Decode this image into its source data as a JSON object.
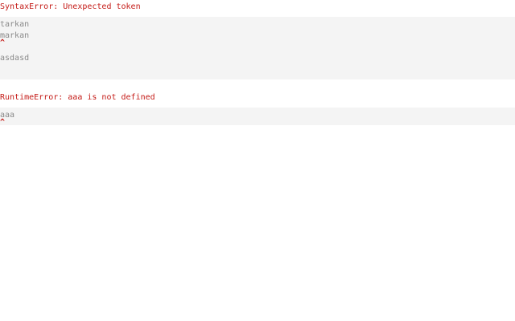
{
  "errors": [
    {
      "title": "SyntaxError: Unexpected token",
      "lines_before_caret": [
        "tarkan",
        "markan"
      ],
      "caret": "^",
      "lines_after_caret": [
        "asdasd"
      ]
    },
    {
      "title": "RuntimeError: aaa is not defined",
      "lines_before_caret": [
        "aaa"
      ],
      "caret": "^",
      "lines_after_caret": []
    }
  ],
  "colors": {
    "error_text": "#c41a16",
    "code_text": "#8a8a8a",
    "code_background": "#f4f4f4"
  }
}
